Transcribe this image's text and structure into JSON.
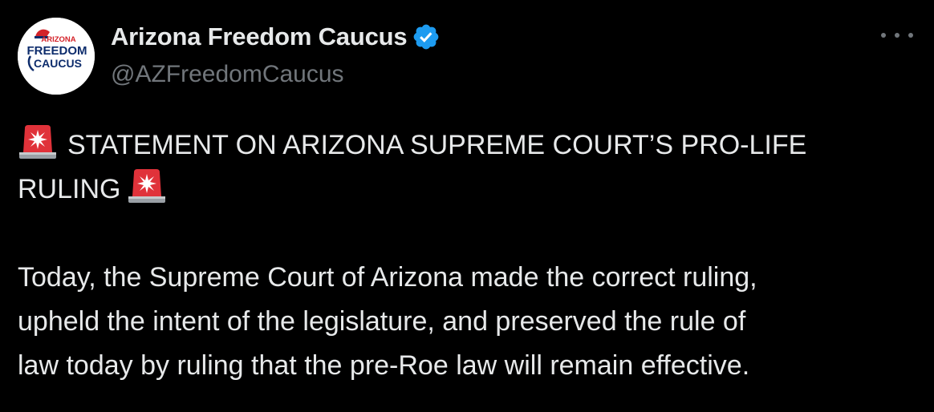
{
  "post": {
    "author": {
      "display_name": "Arizona Freedom Caucus",
      "handle": "@AZFreedomCaucus",
      "verified": true,
      "avatar_text": {
        "line1": "ARIZONA",
        "line2": "FREEDOM",
        "line3": "CAUCUS"
      }
    },
    "more_icon": "more-horizontal-icon",
    "statement_heading_line1": "STATEMENT ON ARIZONA SUPREME COURT’S PRO-LIFE",
    "statement_heading_line2": "RULING",
    "heading_emoji": "police-car-light-icon",
    "paragraph_lines": [
      "Today, the Supreme Court of Arizona made the correct ruling,",
      "upheld the intent of the legislature, and preserved the rule of",
      "law today by ruling that the pre-Roe law will remain effective."
    ]
  },
  "colors": {
    "background": "#000000",
    "primary_text": "#e7e9ea",
    "secondary_text": "#71767b",
    "verified_blue": "#1d9bf0",
    "siren_red": "#e0323a",
    "logo_navy": "#0d2c6c",
    "logo_red": "#d4232a"
  }
}
